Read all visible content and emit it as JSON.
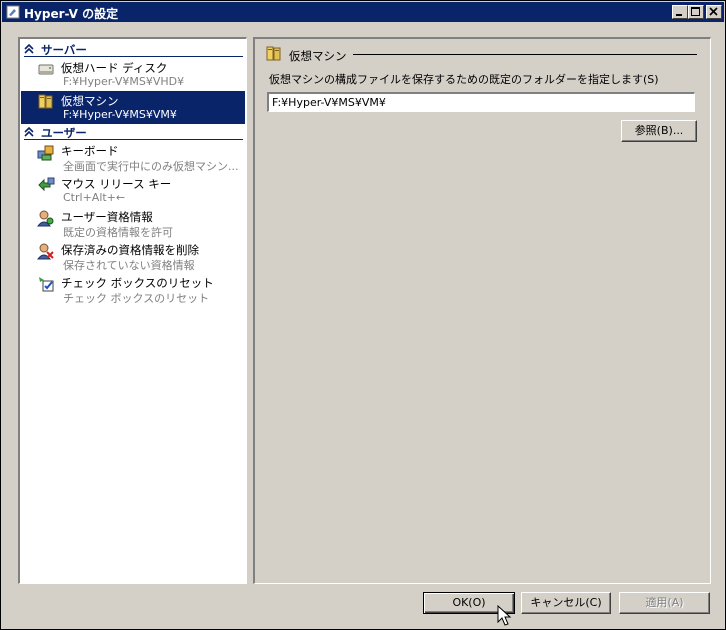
{
  "window": {
    "title": "Hyper-V の設定"
  },
  "sidebar": {
    "server_section": "サーバー",
    "user_section": "ユーザー",
    "server_items": [
      {
        "name": "仮想ハード ディスク",
        "sub": "F:¥Hyper-V¥MS¥VHD¥"
      },
      {
        "name": "仮想マシン",
        "sub": "F:¥Hyper-V¥MS¥VM¥"
      }
    ],
    "user_items": [
      {
        "name": "キーボード",
        "sub": "全画面で実行中にのみ仮想マシン..."
      },
      {
        "name": "マウス リリース キー",
        "sub": "Ctrl+Alt+←"
      },
      {
        "name": "ユーザー資格情報",
        "sub": "既定の資格情報を許可"
      },
      {
        "name": "保存済みの資格情報を削除",
        "sub": "保存されていない資格情報"
      },
      {
        "name": "チェック ボックスのリセット",
        "sub": "チェック ボックスのリセット"
      }
    ]
  },
  "main": {
    "group_title": "仮想マシン",
    "description": "仮想マシンの構成ファイルを保存するための既定のフォルダーを指定します(S)",
    "path_value": "F:¥Hyper-V¥MS¥VM¥",
    "browse_label": "参照(B)..."
  },
  "footer": {
    "ok_label": "OK(O)",
    "cancel_label": "キャンセル(C)",
    "apply_label": "適用(A)"
  },
  "colors": {
    "titlebar": "#0a246a",
    "selection": "#0a246a",
    "face": "#d4d0c8"
  }
}
